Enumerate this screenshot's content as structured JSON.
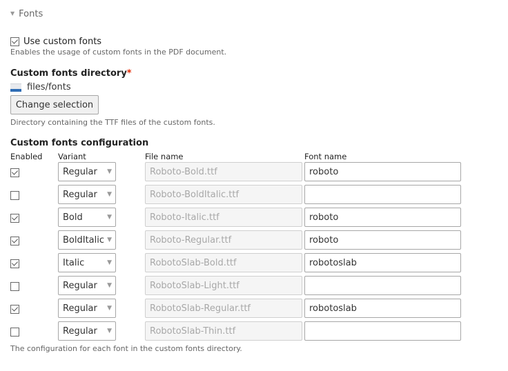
{
  "section": {
    "title": "Fonts",
    "expanded": true
  },
  "use_custom_fonts": {
    "label": "Use custom fonts",
    "checked": true,
    "description": "Enables the usage of custom fonts in the PDF document."
  },
  "custom_fonts_directory": {
    "label": "Custom fonts directory",
    "required_marker": "*",
    "value": "files/fonts",
    "button_label": "Change selection",
    "description": "Directory containing the TTF files of the custom fonts."
  },
  "configuration": {
    "label": "Custom fonts configuration",
    "headers": {
      "enabled": "Enabled",
      "variant": "Variant",
      "file_name": "File name",
      "font_name": "Font name"
    },
    "rows": [
      {
        "enabled": true,
        "variant": "Regular",
        "file_name": "Roboto-Bold.ttf",
        "font_name": "roboto"
      },
      {
        "enabled": false,
        "variant": "Regular",
        "file_name": "Roboto-BoldItalic.ttf",
        "font_name": ""
      },
      {
        "enabled": true,
        "variant": "Bold",
        "file_name": "Roboto-Italic.ttf",
        "font_name": "roboto"
      },
      {
        "enabled": true,
        "variant": "BoldItalic",
        "file_name": "Roboto-Regular.ttf",
        "font_name": "roboto"
      },
      {
        "enabled": true,
        "variant": "Italic",
        "file_name": "RobotoSlab-Bold.ttf",
        "font_name": "robotoslab"
      },
      {
        "enabled": false,
        "variant": "Regular",
        "file_name": "RobotoSlab-Light.ttf",
        "font_name": ""
      },
      {
        "enabled": true,
        "variant": "Regular",
        "file_name": "RobotoSlab-Regular.ttf",
        "font_name": "robotoslab"
      },
      {
        "enabled": false,
        "variant": "Regular",
        "file_name": "RobotoSlab-Thin.ttf",
        "font_name": ""
      }
    ],
    "description": "The configuration for each font in the custom fonts directory."
  },
  "icons": {
    "section_toggle": "triangle-down-icon",
    "directory": "folder-icon",
    "select_arrow": "triangle-down-icon"
  },
  "colors": {
    "required": "#e32700",
    "folder_accent": "#2f6db5"
  }
}
